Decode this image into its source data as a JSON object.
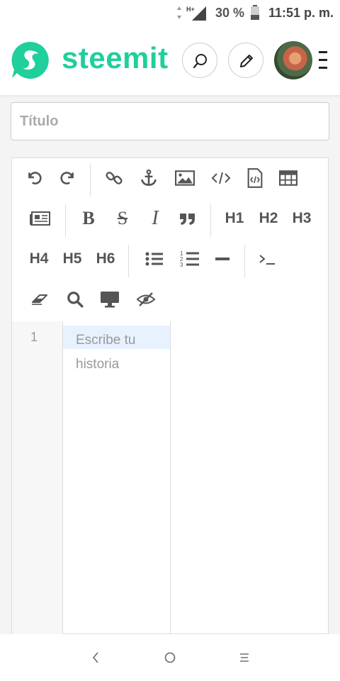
{
  "status_bar": {
    "network_label": "H+",
    "battery": "30 %",
    "time": "11:51 p. m."
  },
  "header": {
    "brand": "steemit",
    "buttons": [
      "search-icon",
      "pencil-icon"
    ],
    "brand_color": "#1fcf9c"
  },
  "title_field": {
    "placeholder": "Título",
    "value": ""
  },
  "toolbar": {
    "row1": [
      "undo-icon",
      "redo-icon",
      "link-icon",
      "anchor-icon",
      "image-icon",
      "code-icon",
      "code-file-icon",
      "table-icon"
    ],
    "row2": [
      "newspaper-icon",
      "bold-icon",
      "strikethrough-icon",
      "italic-icon",
      "quote-icon"
    ],
    "headings_row2": [
      "H1",
      "H2",
      "H3"
    ],
    "headings_row3": [
      "H4",
      "H5",
      "H6"
    ],
    "row3": [
      "bulleted-list-icon",
      "numbered-list-icon",
      "horizontal-rule-icon",
      "terminal-icon"
    ],
    "row4": [
      "eraser-icon",
      "search-icon",
      "monitor-icon",
      "eye-slash-icon"
    ]
  },
  "editor": {
    "line_number": "1",
    "placeholder": "Escribe tu historia"
  },
  "nav_bar": [
    "back-icon",
    "home-icon",
    "recents-icon"
  ]
}
